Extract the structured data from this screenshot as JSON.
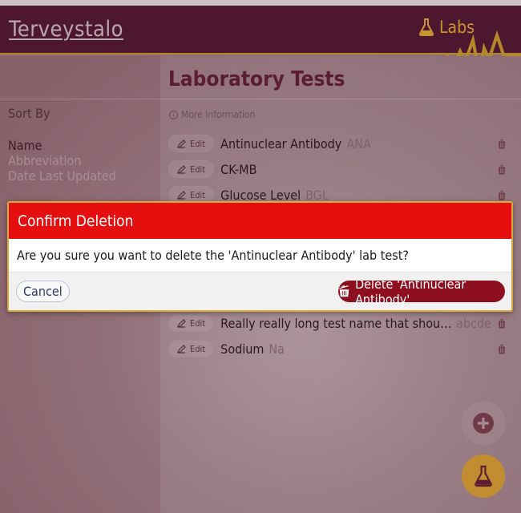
{
  "header": {
    "brand": "Terveystalo",
    "labs_label": "Labs"
  },
  "page": {
    "title": "Laboratory Tests",
    "more_info": "More Information"
  },
  "sidebar": {
    "sort_by": "Sort By",
    "options": [
      "Name",
      "Abbreviation",
      "Date Last Updated"
    ],
    "active_option": "Name"
  },
  "tests": [
    {
      "name": "Antinuclear Antibody",
      "abbr": "ANA"
    },
    {
      "name": "CK-MB",
      "abbr": ""
    },
    {
      "name": "Glucose Level",
      "abbr": "BGL"
    },
    {
      "name": "Really really long test name that should force so...",
      "abbr": "abcde"
    },
    {
      "name": "Sodium",
      "abbr": "Na"
    }
  ],
  "edit_label": "Edit",
  "modal": {
    "title": "Confirm Deletion",
    "message": "Are you sure you want to delete the 'Antinuclear Antibody' lab test?",
    "cancel_label": "Cancel",
    "delete_label": "Delete 'Antinuclear Antibody'"
  },
  "colors": {
    "header_bg": "#4e1730",
    "accent_gold": "#c8962e",
    "modal_header": "#e60f0f",
    "delete_button": "#8e0f20"
  },
  "icons": [
    "flask-icon",
    "pulse-line-icon",
    "info-icon",
    "pencil-icon",
    "trash-icon",
    "plus-circle-icon",
    "trash-open-icon"
  ]
}
